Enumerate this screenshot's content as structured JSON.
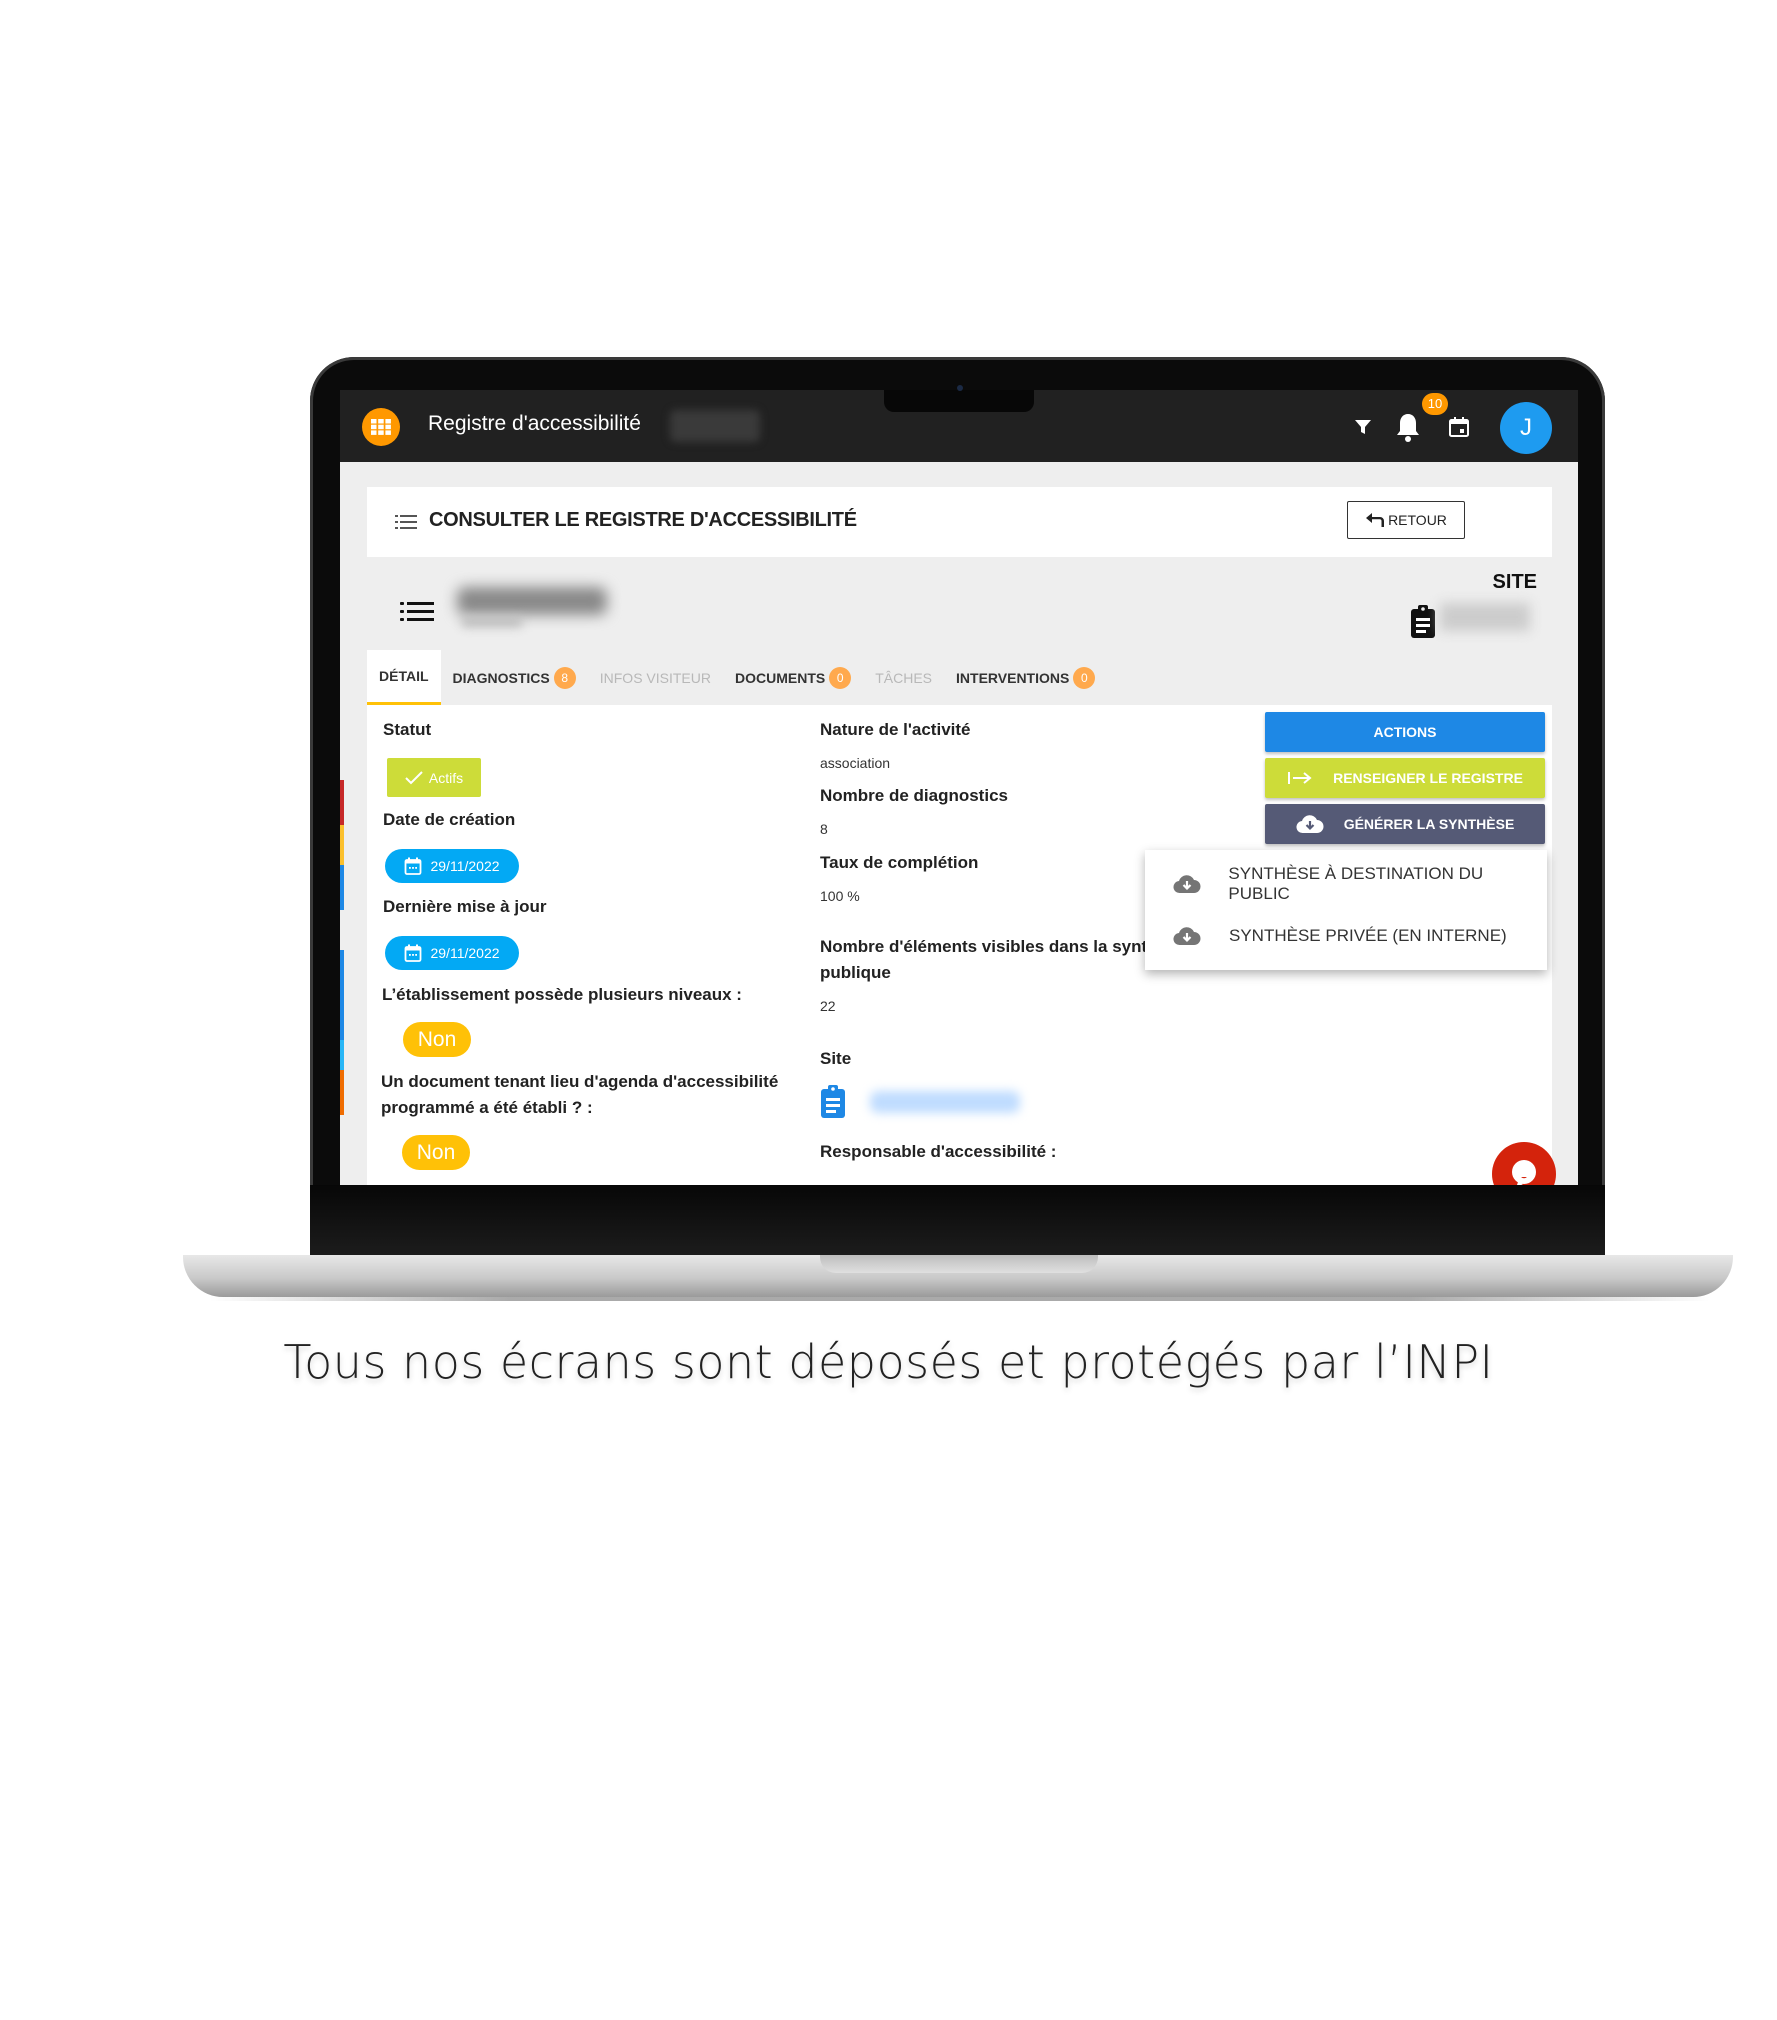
{
  "appbar": {
    "title": "Registre d'accessibilité",
    "notification_count": "10",
    "avatar_initial": "J",
    "icons": [
      "apps-grid-icon",
      "filter-icon",
      "bell-icon",
      "calendar-icon"
    ]
  },
  "page_header": {
    "title": "CONSULTER LE REGISTRE D'ACCESSIBILITÉ",
    "back_button": "RETOUR"
  },
  "record": {
    "type_label": "SITE"
  },
  "tabs": [
    {
      "label": "DÉTAIL",
      "badge": null,
      "state": "active"
    },
    {
      "label": "DIAGNOSTICS",
      "badge": "8",
      "state": "enabled"
    },
    {
      "label": "INFOS VISITEUR",
      "badge": null,
      "state": "disabled"
    },
    {
      "label": "DOCUMENTS",
      "badge": "0",
      "state": "enabled"
    },
    {
      "label": "TÂCHES",
      "badge": null,
      "state": "disabled"
    },
    {
      "label": "INTERVENTIONS",
      "badge": "0",
      "state": "enabled"
    }
  ],
  "detail_left": {
    "statut_label": "Statut",
    "statut_value": "Actifs",
    "creation_label": "Date de création",
    "creation_value": "29/11/2022",
    "update_label": "Dernière mise à jour",
    "update_value": "29/11/2022",
    "niveaux_label": "L’établissement possède plusieurs niveaux :",
    "niveaux_value": "Non",
    "agenda_label_line1": "Un document tenant lieu d'agenda d'accessibilité",
    "agenda_label_line2": "programmé a été établi ? :",
    "agenda_value": "Non"
  },
  "detail_right": {
    "nature_label": "Nature de l'activité",
    "nature_value": "association",
    "nb_diag_label": "Nombre de diagnostics",
    "nb_diag_value": "8",
    "taux_label": "Taux de complétion",
    "taux_value": "100 %",
    "nb_elements_label_line1": "Nombre d'éléments visibles dans la synthèse",
    "nb_elements_label_line2": "publique",
    "nb_elements_value": "22",
    "site_label": "Site",
    "responsable_label": "Responsable d'accessibilité :"
  },
  "actions": {
    "actions_button": "ACTIONS",
    "renseigner_button": "RENSEIGNER LE REGISTRE",
    "generer_button": "GÉNÉRER LA SYNTHÈSE",
    "menu": [
      {
        "label": "SYNTHÈSE À DESTINATION DU PUBLIC",
        "icon": "cloud-download-icon"
      },
      {
        "label": "SYNTHÈSE PRIVÉE (EN INTERNE)",
        "icon": "cloud-download-icon"
      }
    ]
  },
  "colors": {
    "appbar": "#212121",
    "logo": "#ff9800",
    "avatar": "#1e9bf0",
    "status_green": "#cddc39",
    "date_blue": "#03a9f4",
    "non_yellow": "#ffc107",
    "actions_blue": "#1e88e5",
    "generer_slate": "#555a76",
    "fab_red": "#d4230c",
    "tab_badge": "#ffa94d"
  },
  "caption": "Tous nos écrans sont déposés et protégés par l’INPI"
}
